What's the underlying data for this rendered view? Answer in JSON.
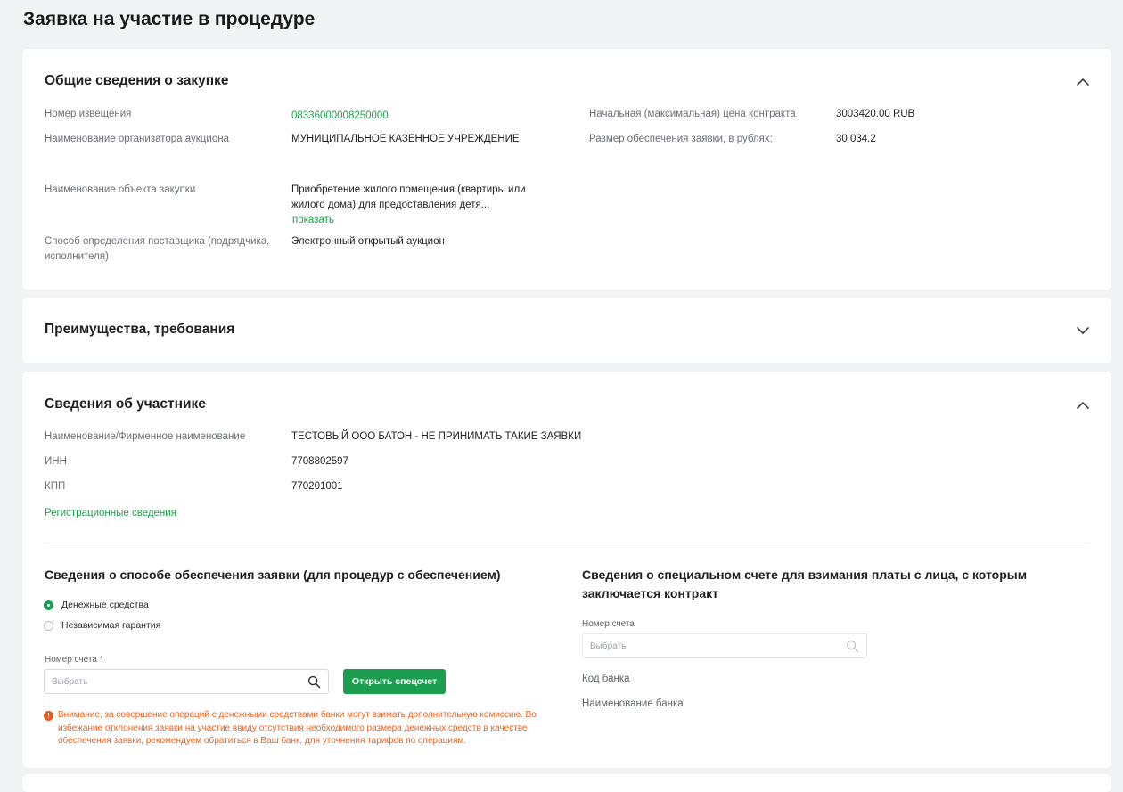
{
  "page_title": "Заявка на участие в процедуре",
  "general": {
    "title": "Общие сведения о закупке",
    "notice_label": "Номер извещения",
    "notice_value": "0833600000825000​0",
    "organizer_label": "Наименование организатора аукциона",
    "organizer_value": "МУНИЦИПАЛЬНОЕ КАЗЕННОЕ УЧРЕЖДЕНИЕ",
    "object_label": "Наименование объекта закупки",
    "object_value": "Приобретение жилого помещения (квартиры или жилого дома) для предоставления детя...",
    "show_link": "показать",
    "method_label": "Способ определения поставщика (подрядчика, исполнителя)",
    "method_value": "Электронный открытый аукцион",
    "price_label": "Начальная (максимальная) цена контракта",
    "price_value": "3003420.00 RUB",
    "security_label": "Размер обеспечения заявки, в рублях:",
    "security_value": "30 034.2"
  },
  "advantages": {
    "title": "Преимущества, требования"
  },
  "participant": {
    "title": "Сведения об участнике",
    "name_label": "Наименование/Фирменное наименование",
    "name_value": "ТЕСТОВЫЙ ООО БАТОН - НЕ ПРИНИМАТЬ ТАКИЕ ЗАЯВКИ",
    "inn_label": "ИНН",
    "inn_value": "7708802597",
    "kpp_label": "КПП",
    "kpp_value": "770201001",
    "reg_link": "Регистрационные сведения"
  },
  "security_method": {
    "title": "Сведения о способе обеспечения заявки (для процедур с обеспечением)",
    "options": [
      {
        "label": "Денежные средства",
        "checked": true
      },
      {
        "label": "Независимая гарантия",
        "checked": false
      }
    ],
    "account_label": "Номер счета *",
    "account_placeholder": "Выбрать",
    "open_button": "Открыть спецсчет",
    "warning": "Внимание, за совершение операций с денежными средствами банки могут взимать дополнительную комиссию. Во избежание отклонения заявки на участие ввиду отсутствия необходимого размера денежных средств в качестве обеспечения заявки, рекомендуем обратиться в Ваш банк, для уточнения тарифов по операциям."
  },
  "special_account": {
    "title": "Сведения о специальном счете для взимания платы с лица, с которым заключается контракт",
    "account_label": "Номер счета",
    "account_placeholder": "Выбрать",
    "bank_code_label": "Код банка",
    "bank_name_label": "Наименование банка"
  },
  "colors": {
    "accent": "#1b9e4f",
    "link": "#20a050",
    "warning": "#e8641f",
    "background": "#f2f3f5"
  }
}
